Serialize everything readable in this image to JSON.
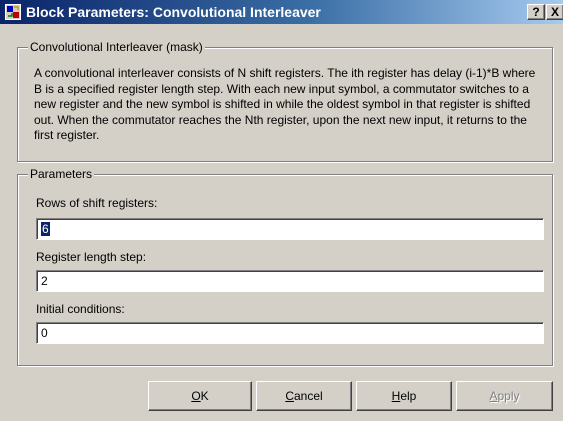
{
  "window": {
    "title": "Block Parameters: Convolutional Interleaver",
    "help_glyph": "?",
    "close_glyph": "X",
    "title_icon": "simulink-block-icon"
  },
  "description": {
    "legend": "Convolutional Interleaver (mask)",
    "text": "A convolutional interleaver consists of N shift registers.  The ith register has delay (i-1)*B where B is a specified register length step.  With each new input symbol, a commutator switches to a new register and the new symbol is shifted in while the oldest symbol in that register is shifted out.  When the commutator reaches the Nth register, upon the next new input, it returns to the first register."
  },
  "parameters": {
    "legend": "Parameters",
    "fields": [
      {
        "label": "Rows of shift registers:",
        "value": "6"
      },
      {
        "label": "Register length step:",
        "value": "2"
      },
      {
        "label": "Initial conditions:",
        "value": "0"
      }
    ]
  },
  "buttons": {
    "ok": {
      "mnemonic": "O",
      "rest": "K"
    },
    "cancel": {
      "mnemonic": "C",
      "rest": "ancel"
    },
    "help": {
      "mnemonic": "H",
      "rest": "elp"
    },
    "apply": {
      "mnemonic": "A",
      "rest": "pply",
      "enabled": false
    }
  },
  "colors": {
    "title_active_start": "#0a246a",
    "title_active_end": "#a6caf0",
    "face": "#d4d0c8",
    "selection": "#0a246a"
  }
}
